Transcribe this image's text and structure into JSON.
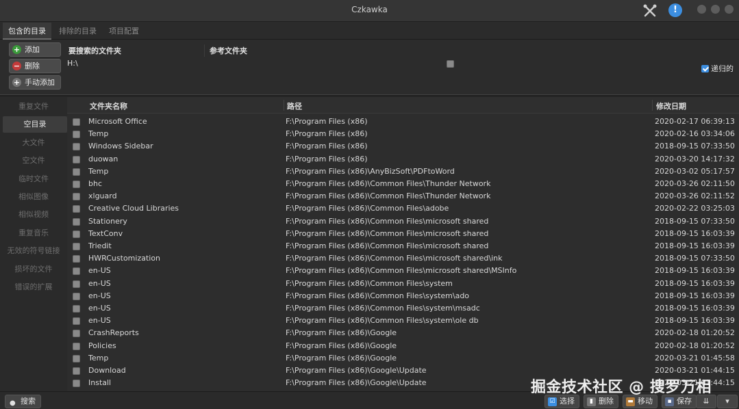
{
  "window": {
    "title": "Czkawka"
  },
  "tabs": [
    {
      "label": "包含的目录",
      "active": true
    },
    {
      "label": "排除的目录",
      "active": false
    },
    {
      "label": "项目配置",
      "active": false
    }
  ],
  "dir_panel": {
    "add_label": "添加",
    "remove_label": "删除",
    "manual_add_label": "手动添加",
    "col_search": "要搜索的文件夹",
    "col_reference": "参考文件夹",
    "included_path": "H:\\",
    "recursive_label": "递归的",
    "recursive_checked": true
  },
  "sidebar": {
    "items": [
      {
        "label": "重复文件",
        "active": false
      },
      {
        "label": "空目录",
        "active": true
      },
      {
        "label": "大文件",
        "active": false
      },
      {
        "label": "空文件",
        "active": false
      },
      {
        "label": "临时文件",
        "active": false
      },
      {
        "label": "相似图像",
        "active": false
      },
      {
        "label": "相似视频",
        "active": false
      },
      {
        "label": "重复音乐",
        "active": false
      },
      {
        "label": "无效的符号链接",
        "active": false
      },
      {
        "label": "损坏的文件",
        "active": false
      },
      {
        "label": "错误的扩展",
        "active": false
      }
    ]
  },
  "table": {
    "headers": {
      "name": "文件夹名称",
      "path": "路径",
      "modified": "修改日期"
    },
    "rows": [
      {
        "name": "Microsoft Office",
        "path": "F:\\Program Files (x86)",
        "modified": "2020-02-17 06:39:13"
      },
      {
        "name": "Temp",
        "path": "F:\\Program Files (x86)",
        "modified": "2020-02-16 03:34:06"
      },
      {
        "name": "Windows Sidebar",
        "path": "F:\\Program Files (x86)",
        "modified": "2018-09-15 07:33:50"
      },
      {
        "name": "duowan",
        "path": "F:\\Program Files (x86)",
        "modified": "2020-03-20 14:17:32"
      },
      {
        "name": "Temp",
        "path": "F:\\Program Files (x86)\\AnyBizSoft\\PDFtoWord",
        "modified": "2020-03-02 05:17:57"
      },
      {
        "name": "bhc",
        "path": "F:\\Program Files (x86)\\Common Files\\Thunder Network",
        "modified": "2020-03-26 02:11:50"
      },
      {
        "name": "xlguard",
        "path": "F:\\Program Files (x86)\\Common Files\\Thunder Network",
        "modified": "2020-03-26 02:11:52"
      },
      {
        "name": "Creative Cloud Libraries",
        "path": "F:\\Program Files (x86)\\Common Files\\adobe",
        "modified": "2020-02-22 03:25:03"
      },
      {
        "name": "Stationery",
        "path": "F:\\Program Files (x86)\\Common Files\\microsoft shared",
        "modified": "2018-09-15 07:33:50"
      },
      {
        "name": "TextConv",
        "path": "F:\\Program Files (x86)\\Common Files\\microsoft shared",
        "modified": "2018-09-15 16:03:39"
      },
      {
        "name": "Triedit",
        "path": "F:\\Program Files (x86)\\Common Files\\microsoft shared",
        "modified": "2018-09-15 16:03:39"
      },
      {
        "name": "HWRCustomization",
        "path": "F:\\Program Files (x86)\\Common Files\\microsoft shared\\ink",
        "modified": "2018-09-15 07:33:50"
      },
      {
        "name": "en-US",
        "path": "F:\\Program Files (x86)\\Common Files\\microsoft shared\\MSInfo",
        "modified": "2018-09-15 16:03:39"
      },
      {
        "name": "en-US",
        "path": "F:\\Program Files (x86)\\Common Files\\system",
        "modified": "2018-09-15 16:03:39"
      },
      {
        "name": "en-US",
        "path": "F:\\Program Files (x86)\\Common Files\\system\\ado",
        "modified": "2018-09-15 16:03:39"
      },
      {
        "name": "en-US",
        "path": "F:\\Program Files (x86)\\Common Files\\system\\msadc",
        "modified": "2018-09-15 16:03:39"
      },
      {
        "name": "en-US",
        "path": "F:\\Program Files (x86)\\Common Files\\system\\ole db",
        "modified": "2018-09-15 16:03:39"
      },
      {
        "name": "CrashReports",
        "path": "F:\\Program Files (x86)\\Google",
        "modified": "2020-02-18 01:20:52"
      },
      {
        "name": "Policies",
        "path": "F:\\Program Files (x86)\\Google",
        "modified": "2020-02-18 01:20:52"
      },
      {
        "name": "Temp",
        "path": "F:\\Program Files (x86)\\Google",
        "modified": "2020-03-21 01:45:58"
      },
      {
        "name": "Download",
        "path": "F:\\Program Files (x86)\\Google\\Update",
        "modified": "2020-03-21 01:44:15"
      },
      {
        "name": "Install",
        "path": "F:\\Program Files (x86)\\Google\\Update",
        "modified": "2020-03-21 01:44:15"
      }
    ]
  },
  "bottom": {
    "search_label": "搜索",
    "select_label": "选择",
    "delete_label": "删除",
    "move_label": "移动",
    "save_label": "保存"
  },
  "watermark": "掘金技术社区 @ 搜罗万相",
  "colors": {
    "accent": "#3c8ee0",
    "background": "#2b2b2b",
    "add_icon": "#3a9a3a",
    "remove_icon": "#c23a3a"
  }
}
